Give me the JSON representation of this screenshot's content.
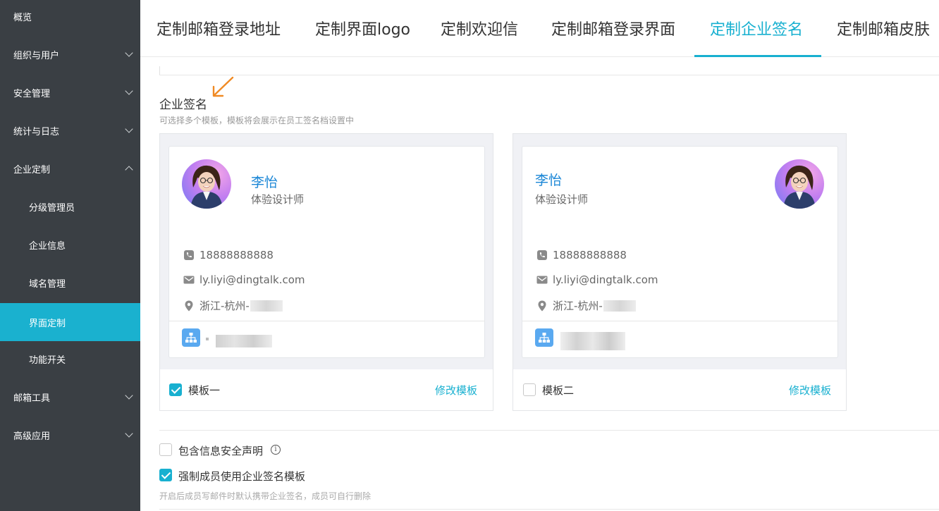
{
  "sidebar": {
    "items": [
      {
        "label": "概览",
        "level": "top",
        "state": "none"
      },
      {
        "label": "组织与用户",
        "level": "top",
        "state": "collapsed"
      },
      {
        "label": "安全管理",
        "level": "top",
        "state": "collapsed"
      },
      {
        "label": "统计与日志",
        "level": "top",
        "state": "collapsed"
      },
      {
        "label": "企业定制",
        "level": "top",
        "state": "expanded"
      },
      {
        "label": "分级管理员",
        "level": "sub",
        "state": "none"
      },
      {
        "label": "企业信息",
        "level": "sub",
        "state": "none"
      },
      {
        "label": "域名管理",
        "level": "sub",
        "state": "none"
      },
      {
        "label": "界面定制",
        "level": "sub",
        "state": "active"
      },
      {
        "label": "功能开关",
        "level": "sub",
        "state": "none"
      },
      {
        "label": "邮箱工具",
        "level": "top",
        "state": "collapsed"
      },
      {
        "label": "高级应用",
        "level": "top",
        "state": "collapsed"
      }
    ]
  },
  "tabs": [
    {
      "label": "定制邮箱登录地址",
      "active": false
    },
    {
      "label": "定制界面logo",
      "active": false
    },
    {
      "label": "定制欢迎信",
      "active": false
    },
    {
      "label": "定制邮箱登录界面",
      "active": false
    },
    {
      "label": "定制企业签名",
      "active": true
    },
    {
      "label": "定制邮箱皮肤",
      "active": false
    }
  ],
  "section": {
    "title": "企业签名",
    "description": "可选择多个模板，模板将会展示在员工签名档设置中"
  },
  "templates": [
    {
      "name": "李怡",
      "job_title": "体验设计师",
      "phone": "18888888888",
      "email": "ly.liyi@dingtalk.com",
      "location": "浙江-杭州-",
      "label": "模板一",
      "checked": true,
      "edit_label": "修改模板",
      "avatar_side": "left"
    },
    {
      "name": "李怡",
      "job_title": "体验设计师",
      "phone": "18888888888",
      "email": "ly.liyi@dingtalk.com",
      "location": "浙江-杭州-",
      "label": "模板二",
      "checked": false,
      "edit_label": "修改模板",
      "avatar_side": "right"
    }
  ],
  "options": {
    "security_statement": {
      "label": "包含信息安全声明",
      "checked": false
    },
    "force_template": {
      "label": "强制成员使用企业签名模板",
      "checked": true,
      "description": "开启后成员写邮件时默认携带企业签名，成员可自行删除"
    }
  },
  "colors": {
    "sidebar_bg": "#3a3f44",
    "accent": "#18b0d0",
    "name_blue": "#1a86d6",
    "annotation_arrow": "#f08a24"
  },
  "icons": {
    "phone": "phone-icon",
    "email": "mail-icon",
    "location": "location-pin-icon",
    "org": "org-chart-icon",
    "info": "info-icon"
  }
}
